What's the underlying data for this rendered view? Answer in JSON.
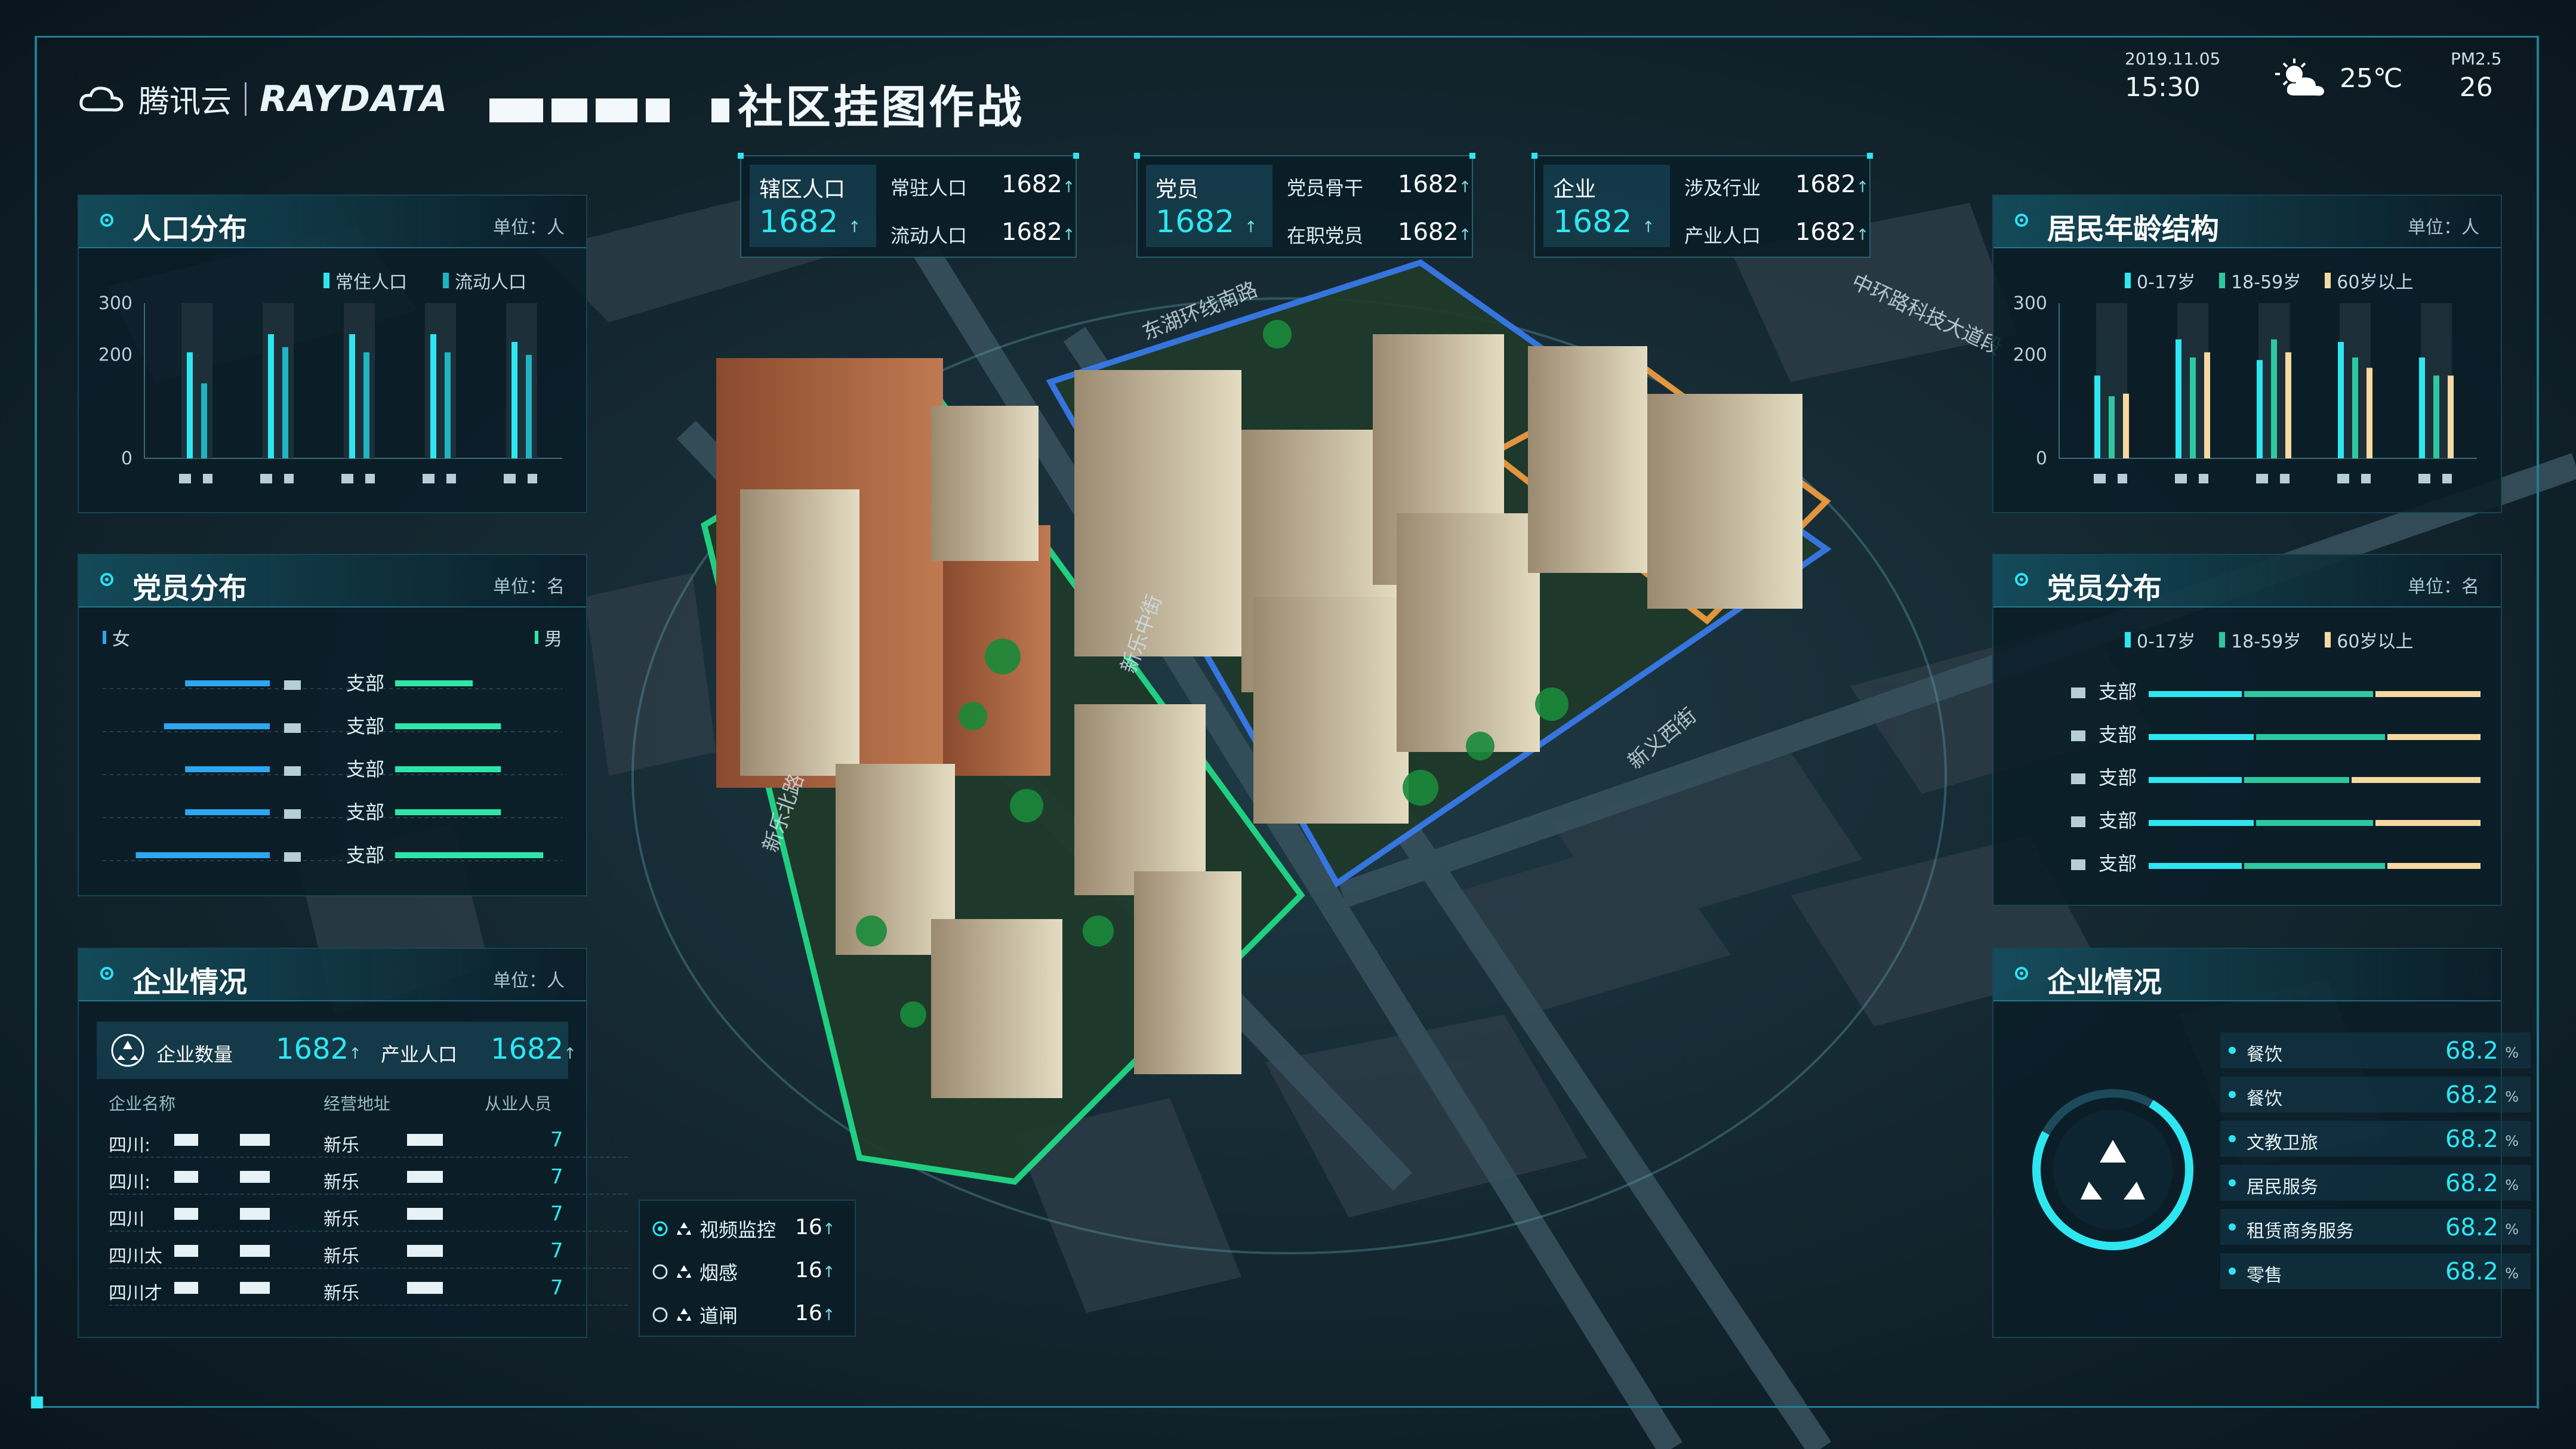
{
  "header": {
    "brand_cn": "腾讯云",
    "brand_en": "RAYDATA",
    "title": "社区挂图作战",
    "date": "2019.11.05",
    "time": "15:30",
    "temperature": "25℃",
    "pm_label": "PM2.5",
    "pm_value": "26",
    "weather_icon": "partly-cloudy-icon"
  },
  "top_stats": [
    {
      "main_label": "辖区人口",
      "main_value": "1682",
      "rows": [
        {
          "label": "常驻人口",
          "value": "1682"
        },
        {
          "label": "流动人口",
          "value": "1682"
        }
      ]
    },
    {
      "main_label": "党员",
      "main_value": "1682",
      "rows": [
        {
          "label": "党员骨干",
          "value": "1682"
        },
        {
          "label": "在职党员",
          "value": "1682"
        }
      ]
    },
    {
      "main_label": "企业",
      "main_value": "1682",
      "rows": [
        {
          "label": "涉及行业",
          "value": "1682"
        },
        {
          "label": "产业人口",
          "value": "1682"
        }
      ]
    }
  ],
  "population_panel": {
    "title": "人口分布",
    "unit": "单位：人",
    "chart_data": {
      "type": "bar",
      "categories": [
        "",
        "",
        "",
        "",
        ""
      ],
      "series": [
        {
          "name": "常住人口",
          "values": [
            205,
            240,
            240,
            240,
            225
          ]
        },
        {
          "name": "流动人口",
          "values": [
            145,
            215,
            205,
            205,
            200
          ]
        }
      ],
      "ylim": [
        0,
        300
      ],
      "yticks": [
        "300",
        "200",
        "0"
      ],
      "colors": [
        "#2ee6f0",
        "#1fb4c2"
      ]
    }
  },
  "party_left_panel": {
    "title": "党员分布",
    "unit": "单位：名",
    "legend_left": "女",
    "legend_right": "男",
    "chart_data": {
      "type": "bar",
      "categories": [
        "支部",
        "支部",
        "支部",
        "支部",
        "支部"
      ],
      "series": [
        {
          "name": "女",
          "values": [
            60,
            75,
            60,
            60,
            95
          ]
        },
        {
          "name": "男",
          "values": [
            55,
            75,
            75,
            75,
            105
          ]
        }
      ],
      "xticks_left": [
        "100",
        "10",
        "0"
      ],
      "xticks_right": [
        "0",
        "10",
        "100"
      ],
      "colors": [
        "#2ea6f0",
        "#2ee6a8"
      ]
    }
  },
  "enterprise_left_panel": {
    "title": "企业情况",
    "unit": "单位：人",
    "count_label": "企业数量",
    "count_value": "1682",
    "industry_label": "产业人口",
    "industry_value": "1682",
    "columns": [
      "企业名称",
      "经营地址",
      "从业人员"
    ],
    "rows": [
      {
        "name": "四川:",
        "addr": "新乐",
        "staff": "7"
      },
      {
        "name": "四川:",
        "addr": "新乐",
        "staff": "7"
      },
      {
        "name": "四川",
        "addr": "新乐",
        "staff": "7"
      },
      {
        "name": "四川太",
        "addr": "新乐",
        "staff": "7"
      },
      {
        "name": "四川才",
        "addr": "新乐",
        "staff": "7"
      }
    ]
  },
  "age_panel": {
    "title": "居民年龄结构",
    "unit": "单位：人",
    "chart_data": {
      "type": "bar",
      "categories": [
        "",
        "",
        "",
        "",
        ""
      ],
      "series": [
        {
          "name": "0-17岁",
          "values": [
            160,
            230,
            190,
            225,
            195
          ]
        },
        {
          "name": "18-59岁",
          "values": [
            120,
            195,
            230,
            195,
            160
          ]
        },
        {
          "name": "60岁以上",
          "values": [
            125,
            205,
            205,
            175,
            160
          ]
        }
      ],
      "ylim": [
        0,
        300
      ],
      "yticks": [
        "300",
        "200",
        "0"
      ],
      "colors": [
        "#2ee6f0",
        "#2ec8a0",
        "#f6d9a0"
      ]
    }
  },
  "party_right_panel": {
    "title": "党员分布",
    "chart_data": {
      "type": "bar",
      "stacked": true,
      "categories": [
        "支部",
        "支部",
        "支部",
        "支部",
        "支部"
      ],
      "series": [
        {
          "name": "0-17岁",
          "values": [
            40,
            45,
            40,
            45,
            40
          ]
        },
        {
          "name": "18-59岁",
          "values": [
            55,
            55,
            45,
            50,
            60
          ]
        },
        {
          "name": "60岁以上",
          "values": [
            45,
            40,
            55,
            45,
            40
          ]
        }
      ],
      "xticks": [
        "0",
        "100",
        "100",
        "100"
      ],
      "colors": [
        "#2ee6f0",
        "#2ec8a0",
        "#f6d9a0"
      ]
    }
  },
  "enterprise_right_panel": {
    "title": "企业情况",
    "items": [
      {
        "name": "餐饮",
        "value": "68.2",
        "pct": "%"
      },
      {
        "name": "餐饮",
        "value": "68.2",
        "pct": "%"
      },
      {
        "name": "文教卫旅",
        "value": "68.2",
        "pct": "%"
      },
      {
        "name": "居民服务",
        "value": "68.2",
        "pct": "%"
      },
      {
        "name": "租赁商务服务",
        "value": "68.2",
        "pct": "%"
      },
      {
        "name": "零售",
        "value": "68.2",
        "pct": "%"
      }
    ]
  },
  "monitor_panel": {
    "items": [
      {
        "name": "视频监控",
        "value": "16"
      },
      {
        "name": "烟感",
        "value": "16"
      },
      {
        "name": "道闸",
        "value": "16"
      }
    ]
  },
  "map_labels": {
    "road1": "东湖环线南路",
    "road2": "新乐中街",
    "road3": "新乐北路",
    "road4": "新义西街",
    "road5": "中环路科技大道段"
  }
}
